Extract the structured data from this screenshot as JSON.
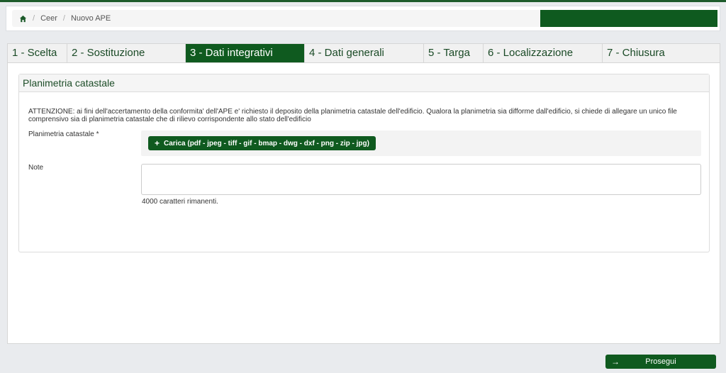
{
  "breadcrumb": {
    "home_icon": "home-icon",
    "items": [
      "Ceer",
      "Nuovo APE"
    ]
  },
  "tabs": [
    {
      "label": "1 - Scelta",
      "active": false
    },
    {
      "label": "2 - Sostituzione",
      "active": false
    },
    {
      "label": "3 - Dati integrativi",
      "active": true
    },
    {
      "label": "4 - Dati generali",
      "active": false
    },
    {
      "label": "5 - Targa",
      "active": false
    },
    {
      "label": "6 - Localizzazione",
      "active": false
    },
    {
      "label": "7 - Chiusura",
      "active": false
    }
  ],
  "section": {
    "title": "Planimetria catastale",
    "notice": "ATTENZIONE: ai fini dell'accertamento della conformita' dell'APE e' richiesto il deposito della planimetria catastale dell'edificio. Qualora la planimetria sia difforme dall'edificio, si chiede di allegare un unico file comprensivo sia di planimetria catastale che di rilievo corrispondente allo stato dell'edificio",
    "planimetria_label": "Planimetria catastale *",
    "upload_label": "Carica (pdf - jpeg - tiff - gif - bmap - dwg - dxf - png - zip - jpg)",
    "note_label": "Note",
    "note_value": "",
    "counter_text": "4000 caratteri rimanenti."
  },
  "footer": {
    "proceed_label": "Prosegui"
  },
  "colors": {
    "primary": "#0f5a1f",
    "tab_text": "#1a4a26"
  }
}
